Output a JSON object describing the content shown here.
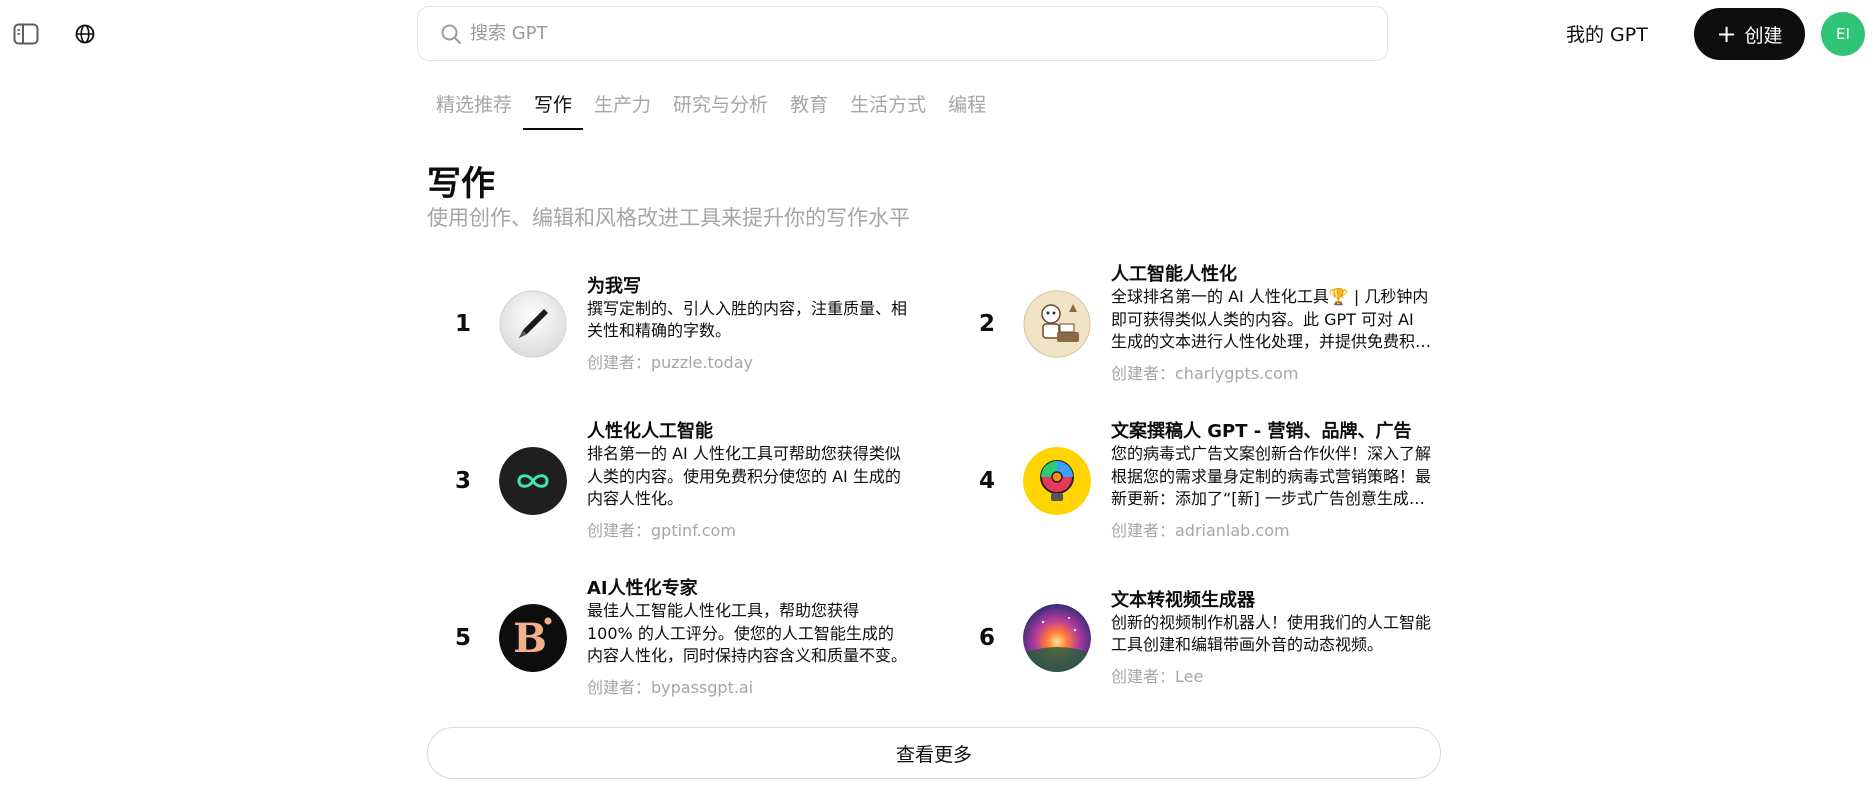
{
  "topbar": {
    "search": {
      "placeholder": "搜索 GPT",
      "icon": "search-icon"
    },
    "my_gpt_label": "我的 GPT",
    "create_label": "创建",
    "avatar_initials": "EI",
    "avatar_color": "#2fc476"
  },
  "tabs": [
    {
      "label": "精选推荐",
      "active": false
    },
    {
      "label": "写作",
      "active": true
    },
    {
      "label": "生产力",
      "active": false
    },
    {
      "label": "研究与分析",
      "active": false
    },
    {
      "label": "教育",
      "active": false
    },
    {
      "label": "生活方式",
      "active": false
    },
    {
      "label": "编程",
      "active": false
    }
  ],
  "section": {
    "title": "写作",
    "subtitle": "使用创作、编辑和风格改进工具来提升你的写作水平"
  },
  "gpts": [
    {
      "rank": "1",
      "name": "为我写",
      "desc": "撰写定制的、引人入胜的内容，注重质量、相关性和精确的字数。",
      "author": "创建者：puzzle.today",
      "logo": "pen-icon"
    },
    {
      "rank": "2",
      "name": "人工智能人性化",
      "desc": "全球排名第一的 AI 人性化工具🏆 | 几秒钟内即可获得类似人类的内容。此 GPT 可对 AI 生成的文本进行人性化处理，并提供免费积分。",
      "author": "创建者：charlygpts.com",
      "logo": "robot-writer-icon"
    },
    {
      "rank": "3",
      "name": "人性化人工智能",
      "desc": "排名第一的 AI 人性化工具可帮助您获得类似人类的内容。使用免费积分使您的 AI 生成的内容人性化。",
      "author": "创建者：gptinf.com",
      "logo": "infinity-icon"
    },
    {
      "rank": "4",
      "name": "文案撰稿人 GPT - 营销、品牌、广告",
      "desc": "您的病毒式广告文案创新合作伙伴！深入了解根据您的需求量身定制的病毒式营销策略！最新更新：添加了“[新] 一步式广告创意生成器”功能。",
      "author": "创建者：adrianlab.com",
      "logo": "lightbulb-icon"
    },
    {
      "rank": "5",
      "name": "AI人性化专家",
      "desc": "最佳人工智能人性化工具，帮助您获得 100% 的人工评分。使您的人工智能生成的内容人性化，同时保持内容含义和质量不变。",
      "author": "创建者：bypassgpt.ai",
      "logo": "letter-b-icon"
    },
    {
      "rank": "6",
      "name": "文本转视频生成器",
      "desc": "创新的视频制作机器人！使用我们的人工智能工具创建和编辑带画外音的动态视频。",
      "author": "创建者：Lee",
      "logo": "galaxy-icon"
    }
  ],
  "more_label": "查看更多"
}
